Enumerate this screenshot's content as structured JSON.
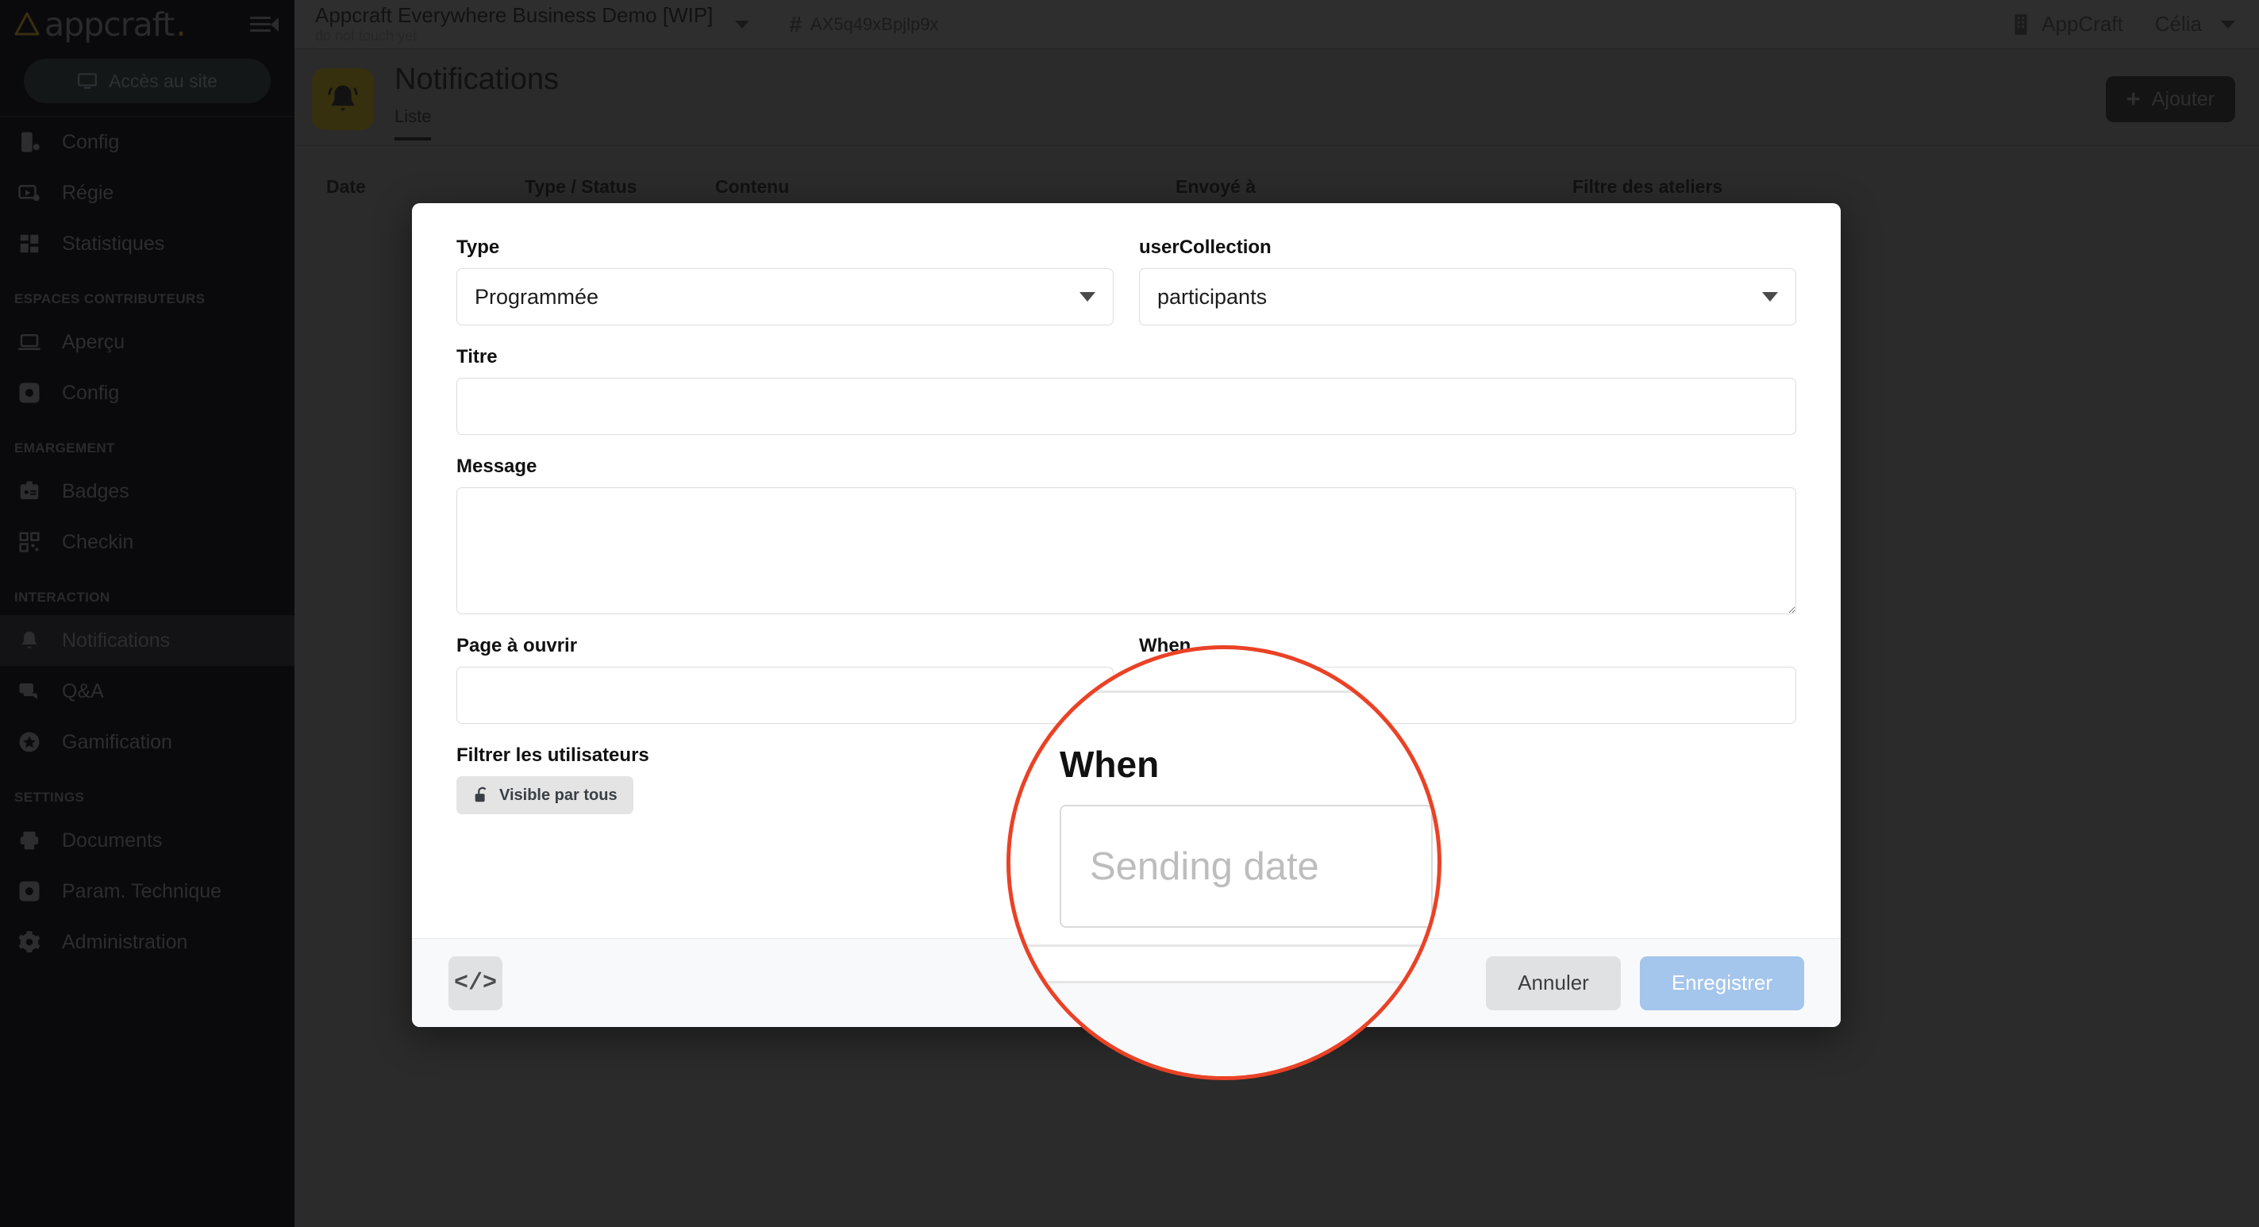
{
  "sidebar": {
    "brand": {
      "name": "appcraft",
      "dot": "."
    },
    "access_button": "Accès au site",
    "groups": [
      {
        "title": "",
        "items": [
          {
            "label": "Config",
            "icon": "mobile-config-icon"
          },
          {
            "label": "Régie",
            "icon": "video-settings-icon"
          },
          {
            "label": "Statistiques",
            "icon": "dashboard-icon"
          }
        ]
      },
      {
        "title": "ESPACES CONTRIBUTEURS",
        "items": [
          {
            "label": "Aperçu",
            "icon": "laptop-icon"
          },
          {
            "label": "Config",
            "icon": "settings-box-icon"
          }
        ]
      },
      {
        "title": "EMARGEMENT",
        "items": [
          {
            "label": "Badges",
            "icon": "badge-icon"
          },
          {
            "label": "Checkin",
            "icon": "qr-code-icon"
          }
        ]
      },
      {
        "title": "INTERACTION",
        "items": [
          {
            "label": "Notifications",
            "icon": "bell-icon",
            "active": true
          },
          {
            "label": "Q&A",
            "icon": "chat-icon"
          },
          {
            "label": "Gamification",
            "icon": "star-badge-icon"
          }
        ]
      },
      {
        "title": "SETTINGS",
        "items": [
          {
            "label": "Documents",
            "icon": "printer-icon"
          },
          {
            "label": "Param. Technique",
            "icon": "settings-box-icon"
          },
          {
            "label": "Administration",
            "icon": "gear-icon"
          }
        ]
      }
    ]
  },
  "topbar": {
    "project_title": "Appcraft Everywhere Business Demo [WIP]",
    "project_subtitle": "do not touch yet",
    "project_id": "AX5q49xBpjlp9x",
    "hash": "#",
    "org_name": "AppCraft",
    "user_name": "Célia"
  },
  "page": {
    "title": "Notifications",
    "tabs": [
      {
        "label": "Liste",
        "active": true
      }
    ],
    "add_button": "Ajouter"
  },
  "table": {
    "columns": [
      "Date",
      "Type / Status",
      "Contenu",
      "Envoyé à",
      "Filtre des ateliers"
    ]
  },
  "modal": {
    "fields": {
      "type_label": "Type",
      "type_value": "Programmée",
      "user_collection_label": "userCollection",
      "user_collection_value": "participants",
      "titre_label": "Titre",
      "titre_value": "",
      "message_label": "Message",
      "message_value": "",
      "page_label": "Page à ouvrir",
      "page_value": "",
      "filter_label": "Filtrer les utilisateurs",
      "filter_chip": "Visible par tous",
      "when_label": "When",
      "when_placeholder": "Sending date",
      "when_value": ""
    },
    "footer": {
      "code_button": "</>",
      "cancel": "Annuler",
      "save": "Enregistrer"
    }
  },
  "magnifier": {
    "label": "When",
    "placeholder": "Sending date",
    "ring_color": "#ea4226"
  }
}
